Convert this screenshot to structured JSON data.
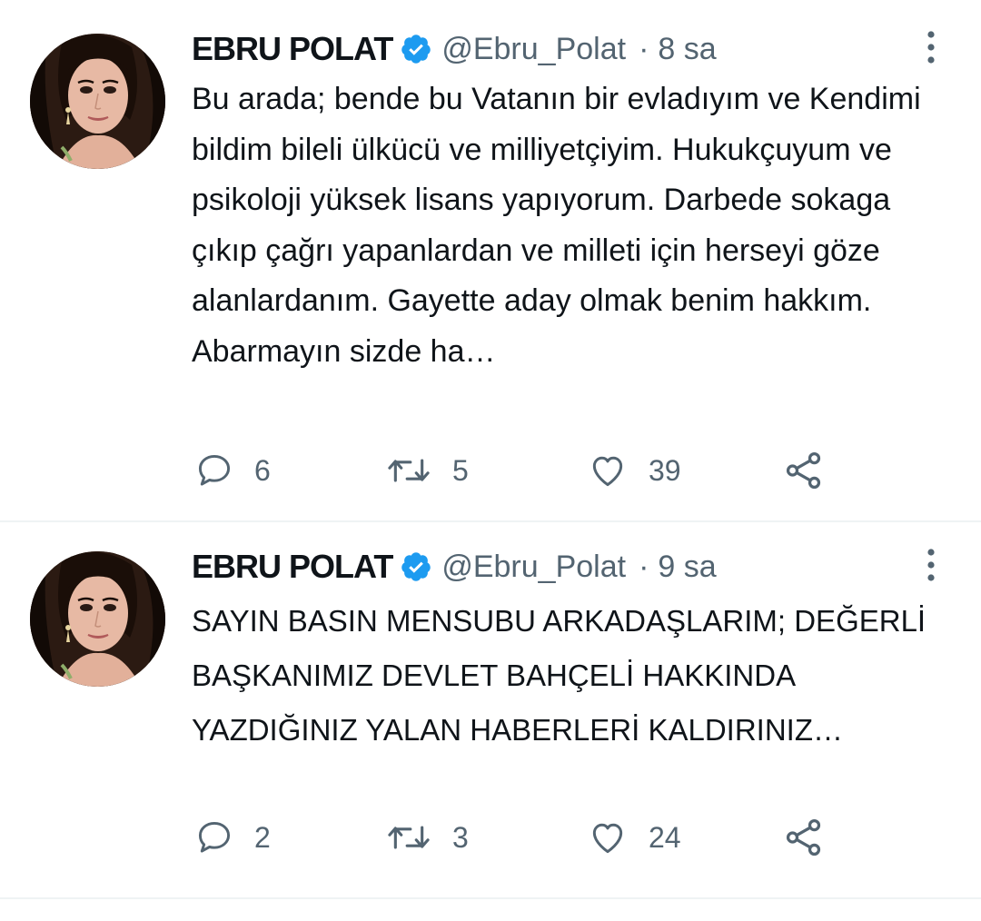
{
  "tweets": [
    {
      "author": {
        "display_name": "EBRU POLAT",
        "handle": "@Ebru_Polat",
        "verified": true
      },
      "separator": "·",
      "time": "8 sa",
      "text": "Bu arada; bende bu Vatanın bir evladıyım ve Kendimi bildim bileli ülkücü ve milliyetçiyim. Hukukçuyum  ve psikoloji yüksek lisans yapıyorum. Darbede sokaga çıkıp çağrı yapanlardan ve milleti için herseyi göze alanlardanım. Gayette aday olmak benim hakkım. Abarmayın sizde ha…",
      "replies": "6",
      "retweets": "5",
      "likes": "39"
    },
    {
      "author": {
        "display_name": "EBRU POLAT",
        "handle": "@Ebru_Polat",
        "verified": true
      },
      "separator": "·",
      "time": "9 sa",
      "text": "SAYIN BASIN MENSUBU ARKADAŞLARIM; DEĞERLİ BAŞKANIMIZ DEVLET BAHÇELİ HAKKINDA YAZDIĞINIZ YALAN HABERLERİ KALDIRINIZ…",
      "replies": "2",
      "retweets": "3",
      "likes": "24"
    }
  ],
  "icons": {
    "verified": "verified-badge-icon",
    "more": "more-vertical-icon",
    "reply": "reply-icon",
    "retweet": "retweet-icon",
    "like": "heart-icon",
    "share": "share-icon"
  },
  "colors": {
    "verified_blue": "#1d9bf0",
    "secondary_text": "#536471",
    "primary_text": "#0f1419",
    "divider": "#eff3f4"
  }
}
